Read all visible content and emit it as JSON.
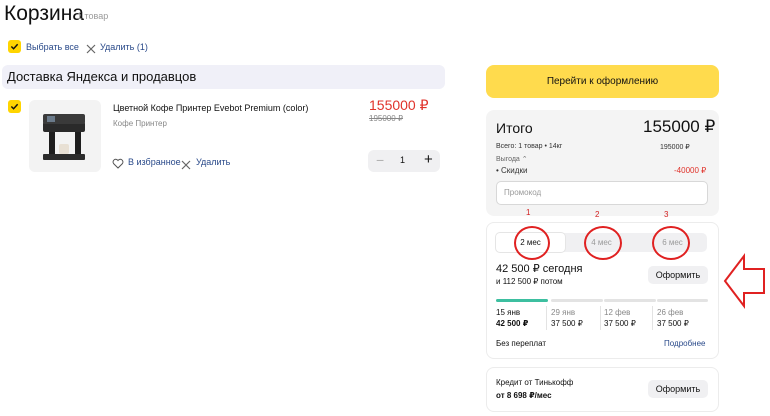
{
  "cart": {
    "title": "Корзина",
    "count": "1 товар"
  },
  "actions": {
    "select_all": "Выбрать все",
    "delete": "Удалить (1)"
  },
  "delivery": {
    "title": "Доставка Яндекса и продавцов"
  },
  "product": {
    "name": "Цветной Кофе Принтер Evebot Premium (color)",
    "category": "Кофе Принтер",
    "price": "155000 ₽",
    "old_price": "195000 ₽",
    "favorite": "В избранное",
    "remove": "Удалить",
    "quantity": "1",
    "minus": "−",
    "plus": "+"
  },
  "checkout": {
    "button": "Перейти к оформлению"
  },
  "summary": {
    "label": "Итого",
    "total": "155000 ₽",
    "items_line": "Всего: 1 товар • 14кг",
    "items_value": "195000 ₽",
    "benefit": "Выгода",
    "discounts": "• Скидки",
    "discounts_value": "-40000 ₽",
    "promo_placeholder": "Промокод"
  },
  "split": {
    "tabs": [
      "2 мес",
      "4 мес",
      "6 мес"
    ],
    "today": "42 500 ₽ сегодня",
    "later": "и 112 500 ₽ потом",
    "button": "Оформить",
    "progress_filled_segments": 1,
    "payments": [
      {
        "date": "15 янв",
        "amount": "42 500 ₽"
      },
      {
        "date": "29 янв",
        "amount": "37 500 ₽"
      },
      {
        "date": "12 фев",
        "amount": "37 500 ₽"
      },
      {
        "date": "26 фев",
        "amount": "37 500 ₽"
      }
    ],
    "no_overpay": "Без переплат",
    "more": "Подробнее"
  },
  "credit": {
    "title": "Кредит от Тинькофф",
    "amount": "от 8 698 ₽/мес",
    "button": "Оформить"
  },
  "annotations": {
    "labels": [
      "1",
      "2",
      "3"
    ]
  },
  "colors": {
    "accent": "#ffdb4d",
    "price_red": "#e0332b",
    "annotation_red": "#e02121",
    "progress_green": "#3dbfa0"
  }
}
